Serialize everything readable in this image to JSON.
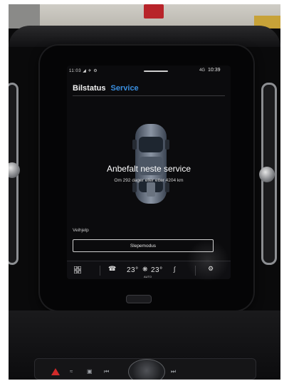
{
  "status_bar": {
    "left_indicators": "11:03 ◢ ✈ ⚙",
    "signal": "4G",
    "time": "10:39"
  },
  "tabs": [
    {
      "label": "Bilstatus"
    },
    {
      "label": "Service"
    }
  ],
  "service": {
    "headline": "Anbefalt neste service",
    "detail": "Om 292 dager eller etter 4204 km"
  },
  "roadside": {
    "section_label": "Veihjelp",
    "tow_mode_button": "Slepemodus"
  },
  "climate": {
    "temp_left": "23°",
    "temp_right": "23°",
    "fan_mode": "AUTO"
  },
  "icons": {
    "apps": "grid-icon",
    "phone": "phone-icon",
    "fan": "fan-icon",
    "seat": "seat-heat-icon",
    "settings": "gear-icon"
  },
  "colors": {
    "accent": "#3a8fe0",
    "screen_bg": "#0b0b0d",
    "hazard": "#d12a2a"
  }
}
